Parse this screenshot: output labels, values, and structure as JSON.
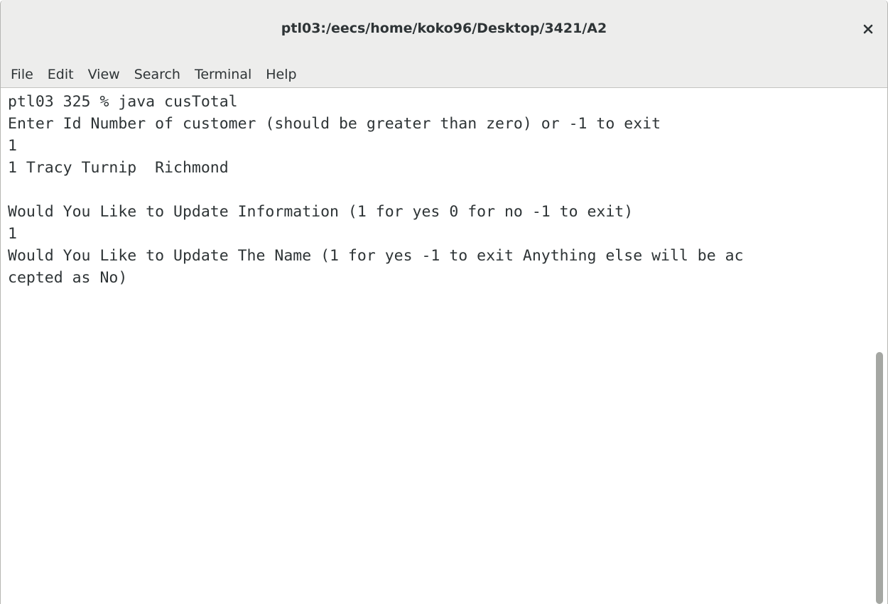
{
  "window": {
    "title": "ptl03:/eecs/home/koko96/Desktop/3421/A2",
    "close_icon": "close-icon"
  },
  "menubar": {
    "items": [
      {
        "label": "File"
      },
      {
        "label": "Edit"
      },
      {
        "label": "View"
      },
      {
        "label": "Search"
      },
      {
        "label": "Terminal"
      },
      {
        "label": "Help"
      }
    ]
  },
  "terminal": {
    "lines": [
      "ptl03 325 % java cusTotal",
      "Enter Id Number of customer (should be greater than zero) or -1 to exit",
      "1",
      "1 Tracy Turnip  Richmond",
      "",
      "Would You Like to Update Information (1 for yes 0 for no -1 to exit)",
      "1",
      "Would You Like to Update The Name (1 for yes -1 to exit Anything else will be ac",
      "cepted as No)"
    ]
  },
  "colors": {
    "chrome": "#ededec",
    "text": "#2e3436",
    "background": "#ffffff",
    "scroll_thumb": "#a5a7a3"
  }
}
